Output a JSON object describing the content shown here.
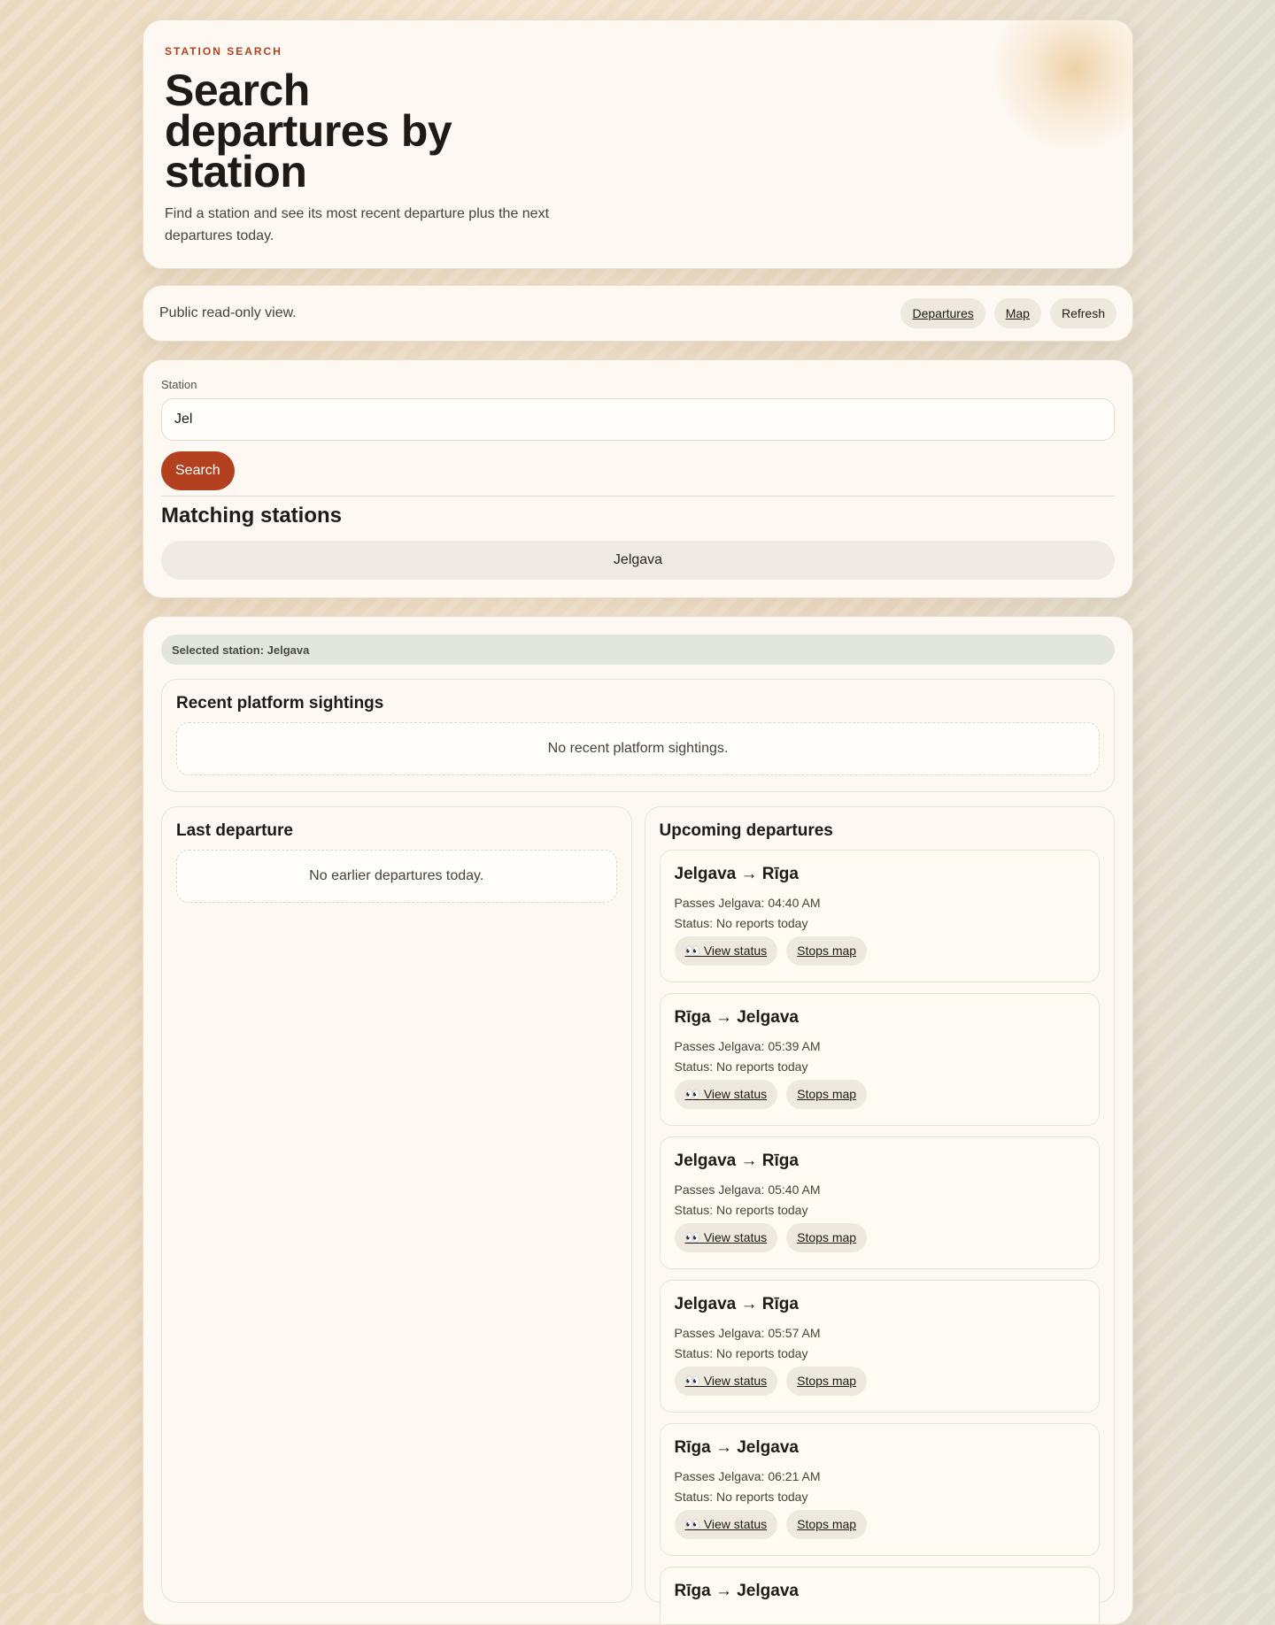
{
  "hero": {
    "eyebrow": "STATION SEARCH",
    "title": "Search departures by station",
    "subtitle": "Find a station and see its most recent departure plus the next departures today."
  },
  "toolbar": {
    "note": "Public read-only view.",
    "links": [
      "Departures",
      "Map",
      "Refresh"
    ]
  },
  "search": {
    "label": "Station",
    "value": "Jel",
    "button": "Search",
    "matches_title": "Matching stations",
    "matches": [
      "Jelgava"
    ]
  },
  "results": {
    "selected": "Selected station: Jelgava",
    "recent_title": "Recent platform sightings",
    "recent_empty": "No recent platform sightings.",
    "last_title": "Last departure",
    "last_empty": "No earlier departures today.",
    "upcoming_title": "Upcoming departures",
    "view_status_label": "👀 View status",
    "stops_map_label": "Stops map",
    "departures": [
      {
        "route": "Jelgava → Rīga",
        "passes": "Passes Jelgava: 04:40 AM",
        "status": "Status: No reports today"
      },
      {
        "route": "Rīga → Jelgava",
        "passes": "Passes Jelgava: 05:39 AM",
        "status": "Status: No reports today"
      },
      {
        "route": "Jelgava → Rīga",
        "passes": "Passes Jelgava: 05:40 AM",
        "status": "Status: No reports today"
      },
      {
        "route": "Jelgava → Rīga",
        "passes": "Passes Jelgava: 05:57 AM",
        "status": "Status: No reports today"
      },
      {
        "route": "Rīga → Jelgava",
        "passes": "Passes Jelgava: 06:21 AM",
        "status": "Status: No reports today"
      },
      {
        "route": "Rīga → Jelgava",
        "passes": "",
        "status": ""
      }
    ]
  },
  "colors": {
    "accent": "#b3401f",
    "card": "#fdf8f1",
    "selected_bg": "#e3e6dc"
  }
}
